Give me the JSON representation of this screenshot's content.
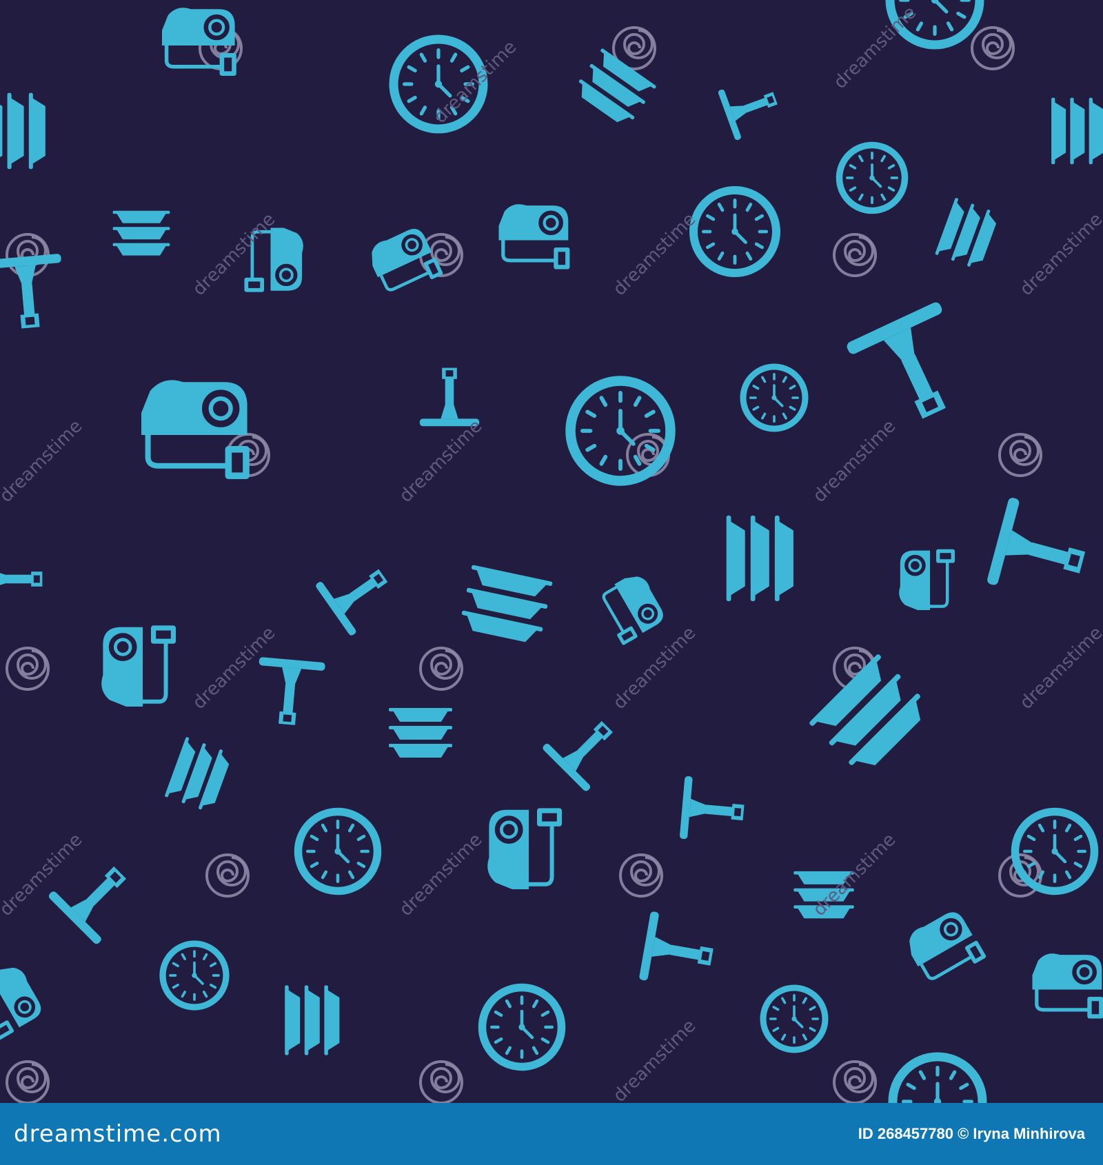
{
  "colors": {
    "background": "#211c40",
    "icon": "#3fb8d8",
    "watermark": "#8e89a6",
    "footer": "#0f77b3"
  },
  "pattern": {
    "icons": [
      "clock-icon",
      "vacuum-cleaner-icon",
      "squeegee-icon",
      "stacked-plates-icon"
    ],
    "watermark_text": "dreamstime"
  },
  "footer": {
    "logo": "dreamstime.com",
    "credit": "ID 268457780 © Iryna Minhirova"
  }
}
